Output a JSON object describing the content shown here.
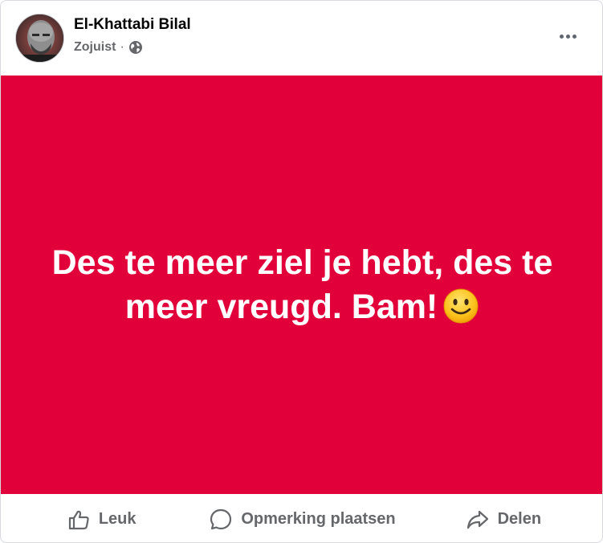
{
  "post": {
    "author": "El-Khattabi Bilal",
    "time": "Zojuist",
    "separator": "·",
    "audience_icon": "globe-icon",
    "text": "Des te meer ziel je hebt, des te meer vreugd. Bam!",
    "emoji": "slightly-smiling-face",
    "background_color": "#e2003b",
    "more_icon": "more-options-icon"
  },
  "actions": {
    "like_label": "Leuk",
    "comment_label": "Opmerking plaatsen",
    "share_label": "Delen"
  },
  "colors": {
    "text_primary": "#050505",
    "text_secondary": "#65676b",
    "post_background": "#e2003b"
  }
}
